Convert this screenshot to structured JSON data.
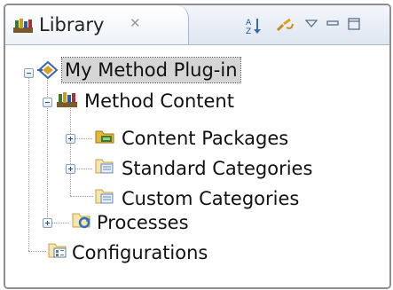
{
  "view": {
    "title": "Library",
    "close_glyph": "✕",
    "icon": "library-icon"
  },
  "toolbar": {
    "items": [
      {
        "name": "sort-icon"
      },
      {
        "name": "link-with-editor-icon"
      },
      {
        "name": "view-menu-icon"
      },
      {
        "name": "minimize-icon"
      },
      {
        "name": "maximize-icon"
      }
    ]
  },
  "tree": {
    "plugin": {
      "label": "My Method Plug-in",
      "icon": "method-plugin-icon",
      "expanded": true,
      "selected": true
    },
    "method_content": {
      "label": "Method Content",
      "icon": "method-content-icon",
      "expanded": true
    },
    "content_packages": {
      "label": "Content Packages",
      "icon": "content-package-icon",
      "expanded": false
    },
    "standard_categories": {
      "label": "Standard Categories",
      "icon": "standard-categories-icon",
      "expanded": false
    },
    "custom_categories": {
      "label": "Custom Categories",
      "icon": "custom-categories-icon"
    },
    "processes": {
      "label": "Processes",
      "icon": "processes-icon",
      "expanded": false
    },
    "configurations": {
      "label": "Configurations",
      "icon": "configurations-icon"
    }
  },
  "colors": {
    "selection": "#d5d5d5",
    "header": "#dfe6f1",
    "border": "#8e8e8e"
  }
}
